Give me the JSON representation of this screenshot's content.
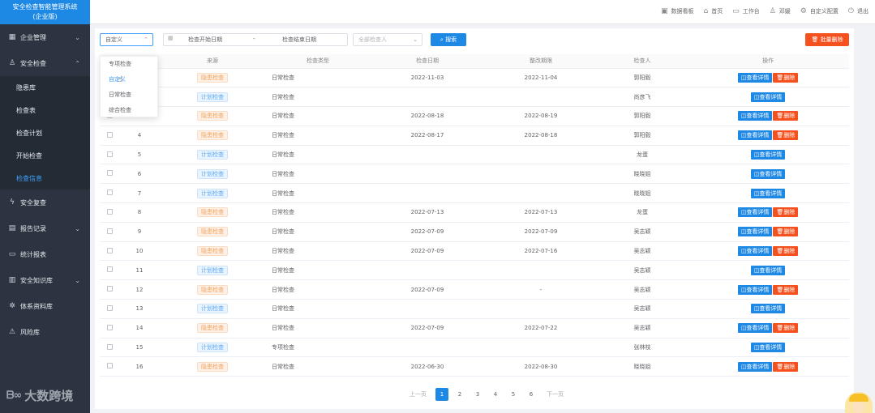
{
  "app": {
    "title_line1": "安全检查智能管理系统",
    "title_line2": "(企业版)"
  },
  "sidebar": {
    "items": [
      {
        "label": "企业管理",
        "icon": "building-icon",
        "expandable": "down"
      },
      {
        "label": "安全检查",
        "icon": "user-check-icon",
        "expandable": "up"
      },
      {
        "label": "安全复查",
        "icon": "bolt-icon",
        "expandable": ""
      },
      {
        "label": "报告记录",
        "icon": "report-icon",
        "expandable": "down"
      },
      {
        "label": "统计报表",
        "icon": "folder-icon",
        "expandable": ""
      },
      {
        "label": "安全知识库",
        "icon": "book-icon",
        "expandable": "down"
      },
      {
        "label": "体系资料库",
        "icon": "gear-icon",
        "expandable": ""
      },
      {
        "label": "风险库",
        "icon": "warning-icon",
        "expandable": ""
      }
    ],
    "sub_items": [
      "隐患库",
      "检查表",
      "检查计划",
      "开始检查",
      "检查信息"
    ],
    "active_sub": "检查信息",
    "watermark": "大数跨境"
  },
  "topnav": [
    {
      "label": "数据看板",
      "icon": "dashboard-icon"
    },
    {
      "label": "首页",
      "icon": "home-icon"
    },
    {
      "label": "工作台",
      "icon": "monitor-icon"
    },
    {
      "label": "邓媛",
      "icon": "user-icon"
    },
    {
      "label": "自定义配置",
      "icon": "settings-icon"
    },
    {
      "label": "退出",
      "icon": "power-icon"
    }
  ],
  "filters": {
    "type_select_value": "自定义",
    "start_date_placeholder": "检查开始日期",
    "date_separator": "-",
    "end_date_placeholder": "检查结束日期",
    "inspector_placeholder": "全部检查人",
    "search_label": "搜索",
    "batch_delete_label": "批量删除"
  },
  "dropdown": {
    "options": [
      "专项检查",
      "自定义",
      "日常检查",
      "综合检查"
    ],
    "highlighted": "自定义"
  },
  "table": {
    "headers": [
      "",
      "",
      "来源",
      "检查类型",
      "检查日期",
      "整改期限",
      "检查人",
      "操作"
    ],
    "view_label": "查看详情",
    "delete_label": "删除",
    "rows": [
      {
        "no": "",
        "source": "隐患检查",
        "kind": "hidden",
        "type": "日常检查",
        "date": "2022-11-03",
        "deadline": "2022-11-04",
        "inspector": "郭阳毅",
        "deletable": true
      },
      {
        "no": "",
        "source": "计划检查",
        "kind": "plan",
        "type": "日常检查",
        "date": "",
        "deadline": "",
        "inspector": "尚彦飞",
        "deletable": false
      },
      {
        "no": "",
        "source": "隐患检查",
        "kind": "hidden",
        "type": "日常检查",
        "date": "2022-08-18",
        "deadline": "2022-08-19",
        "inspector": "郭阳毅",
        "deletable": true
      },
      {
        "no": "4",
        "source": "隐患检查",
        "kind": "hidden",
        "type": "日常检查",
        "date": "2022-08-17",
        "deadline": "2022-08-18",
        "inspector": "郭阳毅",
        "deletable": true
      },
      {
        "no": "5",
        "source": "计划检查",
        "kind": "plan",
        "type": "日常检查",
        "date": "",
        "deadline": "",
        "inspector": "龙蛋",
        "deletable": false
      },
      {
        "no": "6",
        "source": "计划检查",
        "kind": "plan",
        "type": "日常检查",
        "date": "",
        "deadline": "",
        "inspector": "晓晓姐",
        "deletable": false
      },
      {
        "no": "7",
        "source": "计划检查",
        "kind": "plan",
        "type": "日常检查",
        "date": "",
        "deadline": "",
        "inspector": "晓晓姐",
        "deletable": false
      },
      {
        "no": "8",
        "source": "隐患检查",
        "kind": "hidden",
        "type": "日常检查",
        "date": "2022-07-13",
        "deadline": "2022-07-13",
        "inspector": "龙蛋",
        "deletable": true
      },
      {
        "no": "9",
        "source": "隐患检查",
        "kind": "hidden",
        "type": "日常检查",
        "date": "2022-07-09",
        "deadline": "2022-07-09",
        "inspector": "吴志颖",
        "deletable": true
      },
      {
        "no": "10",
        "source": "隐患检查",
        "kind": "hidden",
        "type": "日常检查",
        "date": "2022-07-09",
        "deadline": "2022-07-16",
        "inspector": "吴志颖",
        "deletable": true
      },
      {
        "no": "11",
        "source": "计划检查",
        "kind": "plan",
        "type": "日常检查",
        "date": "",
        "deadline": "",
        "inspector": "吴志颖",
        "deletable": false
      },
      {
        "no": "12",
        "source": "隐患检查",
        "kind": "hidden",
        "type": "日常检查",
        "date": "2022-07-09",
        "deadline": "-",
        "inspector": "吴志颖",
        "deletable": true
      },
      {
        "no": "13",
        "source": "计划检查",
        "kind": "plan",
        "type": "日常检查",
        "date": "",
        "deadline": "",
        "inspector": "吴志颖",
        "deletable": false
      },
      {
        "no": "14",
        "source": "隐患检查",
        "kind": "hidden",
        "type": "日常检查",
        "date": "2022-07-09",
        "deadline": "2022-07-22",
        "inspector": "吴志颖",
        "deletable": true
      },
      {
        "no": "15",
        "source": "计划检查",
        "kind": "plan",
        "type": "专项检查",
        "date": "",
        "deadline": "",
        "inspector": "张林枝",
        "deletable": false
      },
      {
        "no": "16",
        "source": "隐患检查",
        "kind": "hidden",
        "type": "日常检查",
        "date": "2022-06-30",
        "deadline": "2022-08-30",
        "inspector": "晓晓姐",
        "deletable": true
      }
    ]
  },
  "pagination": {
    "prev": "上一页",
    "next": "下一页",
    "pages": [
      "1",
      "2",
      "3",
      "4",
      "5",
      "6"
    ],
    "current": "1"
  },
  "colors": {
    "primary": "#1e88e5",
    "danger": "#f4511e",
    "sidebar": "#2b3440",
    "active_menu": "#3ea2ff"
  }
}
